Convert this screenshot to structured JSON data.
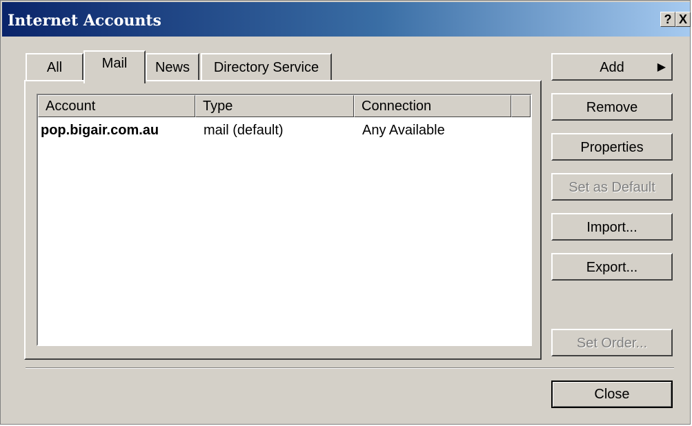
{
  "window": {
    "title": "Internet Accounts",
    "help_glyph": "?",
    "close_glyph": "X"
  },
  "tabs": [
    {
      "label": "All"
    },
    {
      "label": "Mail",
      "selected": true
    },
    {
      "label": "News"
    },
    {
      "label": "Directory Service"
    }
  ],
  "table": {
    "columns": [
      "Account",
      "Type",
      "Connection"
    ],
    "rows": [
      {
        "account": "pop.bigair.com.au",
        "type": "mail (default)",
        "connection": "Any Available"
      }
    ]
  },
  "buttons": {
    "add": "Add",
    "add_arrow": "▶",
    "remove": "Remove",
    "properties": "Properties",
    "set_default": "Set as Default",
    "import": "Import...",
    "export": "Export...",
    "set_order": "Set Order...",
    "close": "Close"
  }
}
